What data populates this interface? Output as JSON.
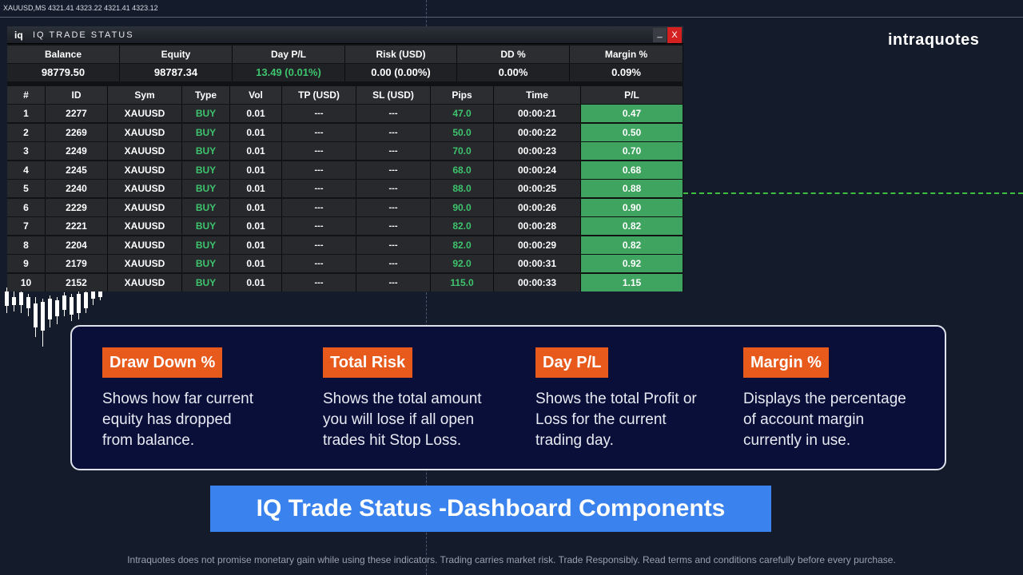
{
  "chart": {
    "symbol_info": "XAUUSD,MS  4321.41 4323.22 4321.41 4323.12",
    "brand": "intraquotes"
  },
  "panel": {
    "logo": "iq",
    "title": "IQ TRADE STATUS",
    "minimize_label": "_",
    "close_label": "X",
    "summary_headers": [
      "Balance",
      "Equity",
      "Day P/L",
      "Risk (USD)",
      "DD %",
      "Margin %"
    ],
    "summary_values": [
      "98779.50",
      "98787.34",
      "13.49 (0.01%)",
      "0.00 (0.00%)",
      "0.00%",
      "0.09%"
    ],
    "table_headers": [
      "#",
      "ID",
      "Sym",
      "Type",
      "Vol",
      "TP (USD)",
      "SL (USD)",
      "Pips",
      "Time",
      "P/L"
    ],
    "rows": [
      [
        "1",
        "2277",
        "XAUUSD",
        "BUY",
        "0.01",
        "---",
        "---",
        "47.0",
        "00:00:21",
        "0.47"
      ],
      [
        "2",
        "2269",
        "XAUUSD",
        "BUY",
        "0.01",
        "---",
        "---",
        "50.0",
        "00:00:22",
        "0.50"
      ],
      [
        "3",
        "2249",
        "XAUUSD",
        "BUY",
        "0.01",
        "---",
        "---",
        "70.0",
        "00:00:23",
        "0.70"
      ],
      [
        "4",
        "2245",
        "XAUUSD",
        "BUY",
        "0.01",
        "---",
        "---",
        "68.0",
        "00:00:24",
        "0.68"
      ],
      [
        "5",
        "2240",
        "XAUUSD",
        "BUY",
        "0.01",
        "---",
        "---",
        "88.0",
        "00:00:25",
        "0.88"
      ],
      [
        "6",
        "2229",
        "XAUUSD",
        "BUY",
        "0.01",
        "---",
        "---",
        "90.0",
        "00:00:26",
        "0.90"
      ],
      [
        "7",
        "2221",
        "XAUUSD",
        "BUY",
        "0.01",
        "---",
        "---",
        "82.0",
        "00:00:28",
        "0.82"
      ],
      [
        "8",
        "2204",
        "XAUUSD",
        "BUY",
        "0.01",
        "---",
        "---",
        "82.0",
        "00:00:29",
        "0.82"
      ],
      [
        "9",
        "2179",
        "XAUUSD",
        "BUY",
        "0.01",
        "---",
        "---",
        "92.0",
        "00:00:31",
        "0.92"
      ],
      [
        "10",
        "2152",
        "XAUUSD",
        "BUY",
        "0.01",
        "---",
        "---",
        "115.0",
        "00:00:33",
        "1.15"
      ]
    ]
  },
  "components": [
    {
      "title": "Draw Down %",
      "desc": [
        "Shows how far current",
        "equity has dropped",
        "from balance."
      ]
    },
    {
      "title": "Total Risk",
      "desc": [
        "Shows the total amount",
        "you will lose if all open",
        "trades hit Stop Loss."
      ]
    },
    {
      "title": "Day P/L",
      "desc": [
        "Shows the total Profit or",
        "Loss for the current",
        "trading day."
      ]
    },
    {
      "title": "Margin %",
      "desc": [
        "Displays the percentage",
        "of account margin",
        "currently in use."
      ]
    }
  ],
  "banner": "IQ Trade Status -Dashboard Components",
  "disclaimer": "Intraquotes does not promise monetary gain while using these indicators. Trading carries market risk. Trade Responsibly. Read terms and conditions carefully before every purchase.",
  "colors": {
    "background": "#141c2b",
    "profit_green": "#3ec46d",
    "pl_fill": "#3fa45f",
    "badge_orange": "#e85a1c",
    "banner_blue": "#3a82ee",
    "close_red": "#d42020"
  }
}
